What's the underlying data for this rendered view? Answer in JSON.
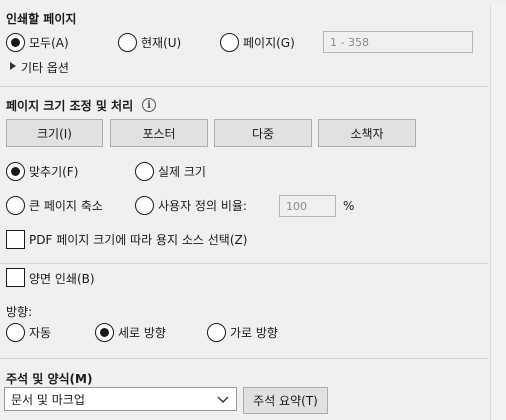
{
  "print_range": {
    "title": "인쇄할 페이지",
    "options": [
      {
        "label": "모두(A)",
        "checked": true
      },
      {
        "label": "현재(U)",
        "checked": false
      },
      {
        "label": "페이지(G)",
        "checked": false
      }
    ],
    "pages_placeholder": "1 - 358",
    "more_options": "기타 옵션"
  },
  "page_sizing": {
    "title": "페이지 크기 조정 및 처리",
    "info_icon": "i",
    "buttons": [
      "크기(I)",
      "포스터",
      "다중",
      "소책자"
    ],
    "fit": "맞추기(F)",
    "actual_size": "실제 크기",
    "shrink": "큰 페이지 축소",
    "custom_scale": "사용자 정의 비율:",
    "scale_value": "100",
    "percent": "%",
    "paper_source": "PDF 페이지 크기에 따라 용지 소스 선택(Z)"
  },
  "duplex": {
    "label": "양면 인쇄(B)"
  },
  "orientation": {
    "title": "방향:",
    "auto": "자동",
    "portrait": "세로 방향",
    "landscape": "가로 방향"
  },
  "comments": {
    "title": "주석 및 양식(M)",
    "selected": "문서 및 마크업",
    "summary_button": "주석 요약(T)"
  }
}
